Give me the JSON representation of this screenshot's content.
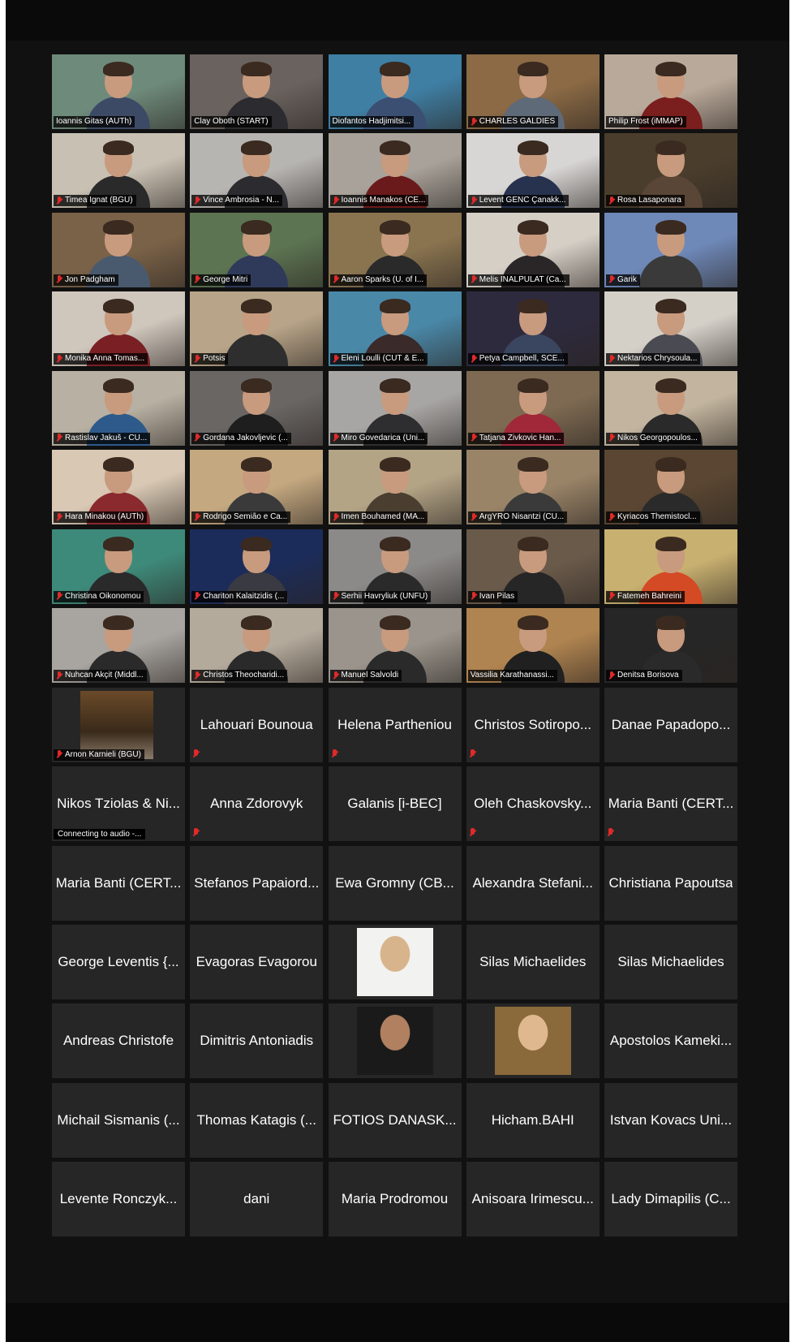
{
  "meeting": {
    "video_tiles": [
      {
        "name": "Ioannis Gitas (AUTh)",
        "muted": false,
        "active": false,
        "bg": "#6e8a7a",
        "body": "#3d4a66"
      },
      {
        "name": "Clay Oboth (START)",
        "muted": false,
        "active": true,
        "bg": "#6a625e",
        "body": "#2b2b30"
      },
      {
        "name": "Diofantos Hadjimitsi...",
        "muted": false,
        "active": false,
        "bg": "#3f7fa4",
        "body": "#3b4f73"
      },
      {
        "name": "CHARLES GALDIES",
        "muted": true,
        "active": false,
        "bg": "#8b6a45",
        "body": "#5f6a78"
      },
      {
        "name": "Philip Frost (iMMAP)",
        "muted": false,
        "active": false,
        "bg": "#b9a99a",
        "body": "#7a1e1e"
      },
      {
        "name": "Timea Ignat (BGU)",
        "muted": true,
        "active": false,
        "bg": "#c8c0b2",
        "body": "#2a2a2a"
      },
      {
        "name": "Vince Ambrosia - N...",
        "muted": true,
        "active": false,
        "bg": "#b7b5b2",
        "body": "#2c2c30"
      },
      {
        "name": "Ioannis Manakos (CE...",
        "muted": true,
        "active": false,
        "bg": "#a8a29a",
        "body": "#6a1a1a"
      },
      {
        "name": "Levent GENC Çanakk...",
        "muted": true,
        "active": false,
        "bg": "#d8d6d4",
        "body": "#26324e"
      },
      {
        "name": "Rosa Lasaponara",
        "muted": true,
        "active": false,
        "bg": "#4a3d2c",
        "body": "#5a4636"
      },
      {
        "name": "Jon Padgham",
        "muted": true,
        "active": false,
        "bg": "#7a6248",
        "body": "#4a5a6e"
      },
      {
        "name": "George Mitri",
        "muted": true,
        "active": false,
        "bg": "#5c7452",
        "body": "#2f3a5a"
      },
      {
        "name": "Aaron Sparks (U. of I...",
        "muted": true,
        "active": false,
        "bg": "#8a7450",
        "body": "#2a2a2a"
      },
      {
        "name": "Melis INALPULAT (Ca...",
        "muted": true,
        "active": false,
        "bg": "#d6cfc6",
        "body": "#2a2628"
      },
      {
        "name": "Garik",
        "muted": true,
        "active": false,
        "bg": "#6e88b8",
        "body": "#3a3a3a"
      },
      {
        "name": "Monika Anna Tomas...",
        "muted": true,
        "active": false,
        "bg": "#cfc6bc",
        "body": "#7a2024"
      },
      {
        "name": "Potsis",
        "muted": true,
        "active": false,
        "bg": "#b8a488",
        "body": "#2e2e2e"
      },
      {
        "name": "Eleni Loulli (CUT & E...",
        "muted": true,
        "active": false,
        "bg": "#4a88a8",
        "body": "#3a2a2a"
      },
      {
        "name": "Petya Campbell, SCE...",
        "muted": true,
        "active": false,
        "bg": "#2e2a3e",
        "body": "#3a4660"
      },
      {
        "name": "Nektarios Chrysoula...",
        "muted": true,
        "active": false,
        "bg": "#d4d0c8",
        "body": "#4a4a52"
      },
      {
        "name": "Rastislav Jakuš - CU...",
        "muted": true,
        "active": false,
        "bg": "#b8b0a2",
        "body": "#2d5a8a"
      },
      {
        "name": "Gordana Jakovljevic (...",
        "muted": true,
        "active": false,
        "bg": "#6a6664",
        "body": "#1e1e1e"
      },
      {
        "name": "Miro Govedarica (Uni...",
        "muted": true,
        "active": false,
        "bg": "#a8a6a4",
        "body": "#2e2e30"
      },
      {
        "name": "Tatjana Zivkovic Han...",
        "muted": true,
        "active": false,
        "bg": "#7e6a52",
        "body": "#a02838"
      },
      {
        "name": "Nikos Georgopoulos...",
        "muted": true,
        "active": false,
        "bg": "#c2b49e",
        "body": "#2a2a2a"
      },
      {
        "name": "Hara Minakou (AUTh)",
        "muted": true,
        "active": false,
        "bg": "#d8c8b4",
        "body": "#8a2a2e"
      },
      {
        "name": "Rodrigo Semião e Ca...",
        "muted": true,
        "active": false,
        "bg": "#c4a880",
        "body": "#3a3a3a"
      },
      {
        "name": "Imen Bouhamed (MA...",
        "muted": true,
        "active": false,
        "bg": "#b4a486",
        "body": "#4a3e30"
      },
      {
        "name": "ArgYRO Nisantzi (CU...",
        "muted": true,
        "active": false,
        "bg": "#9a8468",
        "body": "#3a3a3a"
      },
      {
        "name": "Kyriacos Themistocl...",
        "muted": true,
        "active": false,
        "bg": "#5a4632",
        "body": "#2a2a2a"
      },
      {
        "name": "Christina Oikonomou",
        "muted": true,
        "active": false,
        "bg": "#3e8a7a",
        "body": "#2a2a2a"
      },
      {
        "name": "Chariton Kalaitzidis (...",
        "muted": true,
        "active": false,
        "bg": "#1c2c5a",
        "body": "#3a3a42"
      },
      {
        "name": "Serhii Havryliuk (UNFU)",
        "muted": true,
        "active": false,
        "bg": "#8c8a88",
        "body": "#2a2a2a"
      },
      {
        "name": "Ivan Pilas",
        "muted": true,
        "active": false,
        "bg": "#6a5a4a",
        "body": "#262626"
      },
      {
        "name": "Fatemeh Bahreini",
        "muted": true,
        "active": false,
        "bg": "#c8b070",
        "body": "#d44a24"
      },
      {
        "name": "Nuhcan Akçit (Middl...",
        "muted": true,
        "active": false,
        "bg": "#a8a4a0",
        "body": "#2a2a2a"
      },
      {
        "name": "Christos Theocharidi...",
        "muted": true,
        "active": false,
        "bg": "#b4aa9c",
        "body": "#2a2a2a"
      },
      {
        "name": "Manuel Salvoldi",
        "muted": true,
        "active": false,
        "bg": "#9a948c",
        "body": "#2a2a2a"
      },
      {
        "name": "Vassilia Karathanassi...",
        "muted": false,
        "active": false,
        "bg": "#b08450",
        "body": "#202020"
      },
      {
        "name": "Denitsa Borisova",
        "muted": true,
        "active": false,
        "bg": "#262626",
        "body": "#2a2a2a"
      }
    ],
    "name_tiles_row9": [
      {
        "name": "Arnon Karnieli (BGU)",
        "muted": true,
        "photo": true
      },
      {
        "name": "Lahouari Bounoua",
        "muted": true
      },
      {
        "name": "Helena Partheniou",
        "muted": true
      },
      {
        "name": "Christos Sotiropo...",
        "muted": true
      },
      {
        "name": "Danae Papadopo...",
        "muted": false
      }
    ],
    "name_tiles": [
      {
        "name": "Nikos Tziolas & Ni...",
        "audio_label": "Connecting to audio -..."
      },
      {
        "name": "Anna Zdorovyk",
        "muted": true
      },
      {
        "name": "Galanis [i-BEC]"
      },
      {
        "name": "Oleh Chaskovsky...",
        "muted": true
      },
      {
        "name": "Maria Banti (CERT...",
        "muted": true
      },
      {
        "name": "Maria Banti (CERT..."
      },
      {
        "name": "Stefanos Papaiord..."
      },
      {
        "name": "Ewa Gromny (CB..."
      },
      {
        "name": "Alexandra Stefani..."
      },
      {
        "name": "Christiana Papoutsa"
      },
      {
        "name": "George Leventis {..."
      },
      {
        "name": "Evagoras Evagorou"
      },
      {
        "name": "",
        "photo": true,
        "photo_colors": [
          "#f2f2f0",
          "#d8b48c"
        ]
      },
      {
        "name": "Silas Michaelides"
      },
      {
        "name": "Silas Michaelides"
      },
      {
        "name": "Andreas Christofe"
      },
      {
        "name": "Dimitris Antoniadis"
      },
      {
        "name": "",
        "photo": true,
        "photo_colors": [
          "#1a1a1a",
          "#b08060"
        ]
      },
      {
        "name": "",
        "photo": true,
        "photo_colors": [
          "#8a6a3a",
          "#e0b890"
        ]
      },
      {
        "name": "Apostolos Kameki..."
      },
      {
        "name": "Michail Sismanis (..."
      },
      {
        "name": "Thomas Katagis (..."
      },
      {
        "name": "FOTIOS DANASK..."
      },
      {
        "name": "Hicham.BAHI"
      },
      {
        "name": "Istvan Kovacs Uni..."
      },
      {
        "name": "Levente Ronczyk..."
      },
      {
        "name": "dani"
      },
      {
        "name": "Maria Prodromou"
      },
      {
        "name": "Anisoara Irimescu..."
      },
      {
        "name": "Lady Dimapilis (C..."
      }
    ]
  }
}
